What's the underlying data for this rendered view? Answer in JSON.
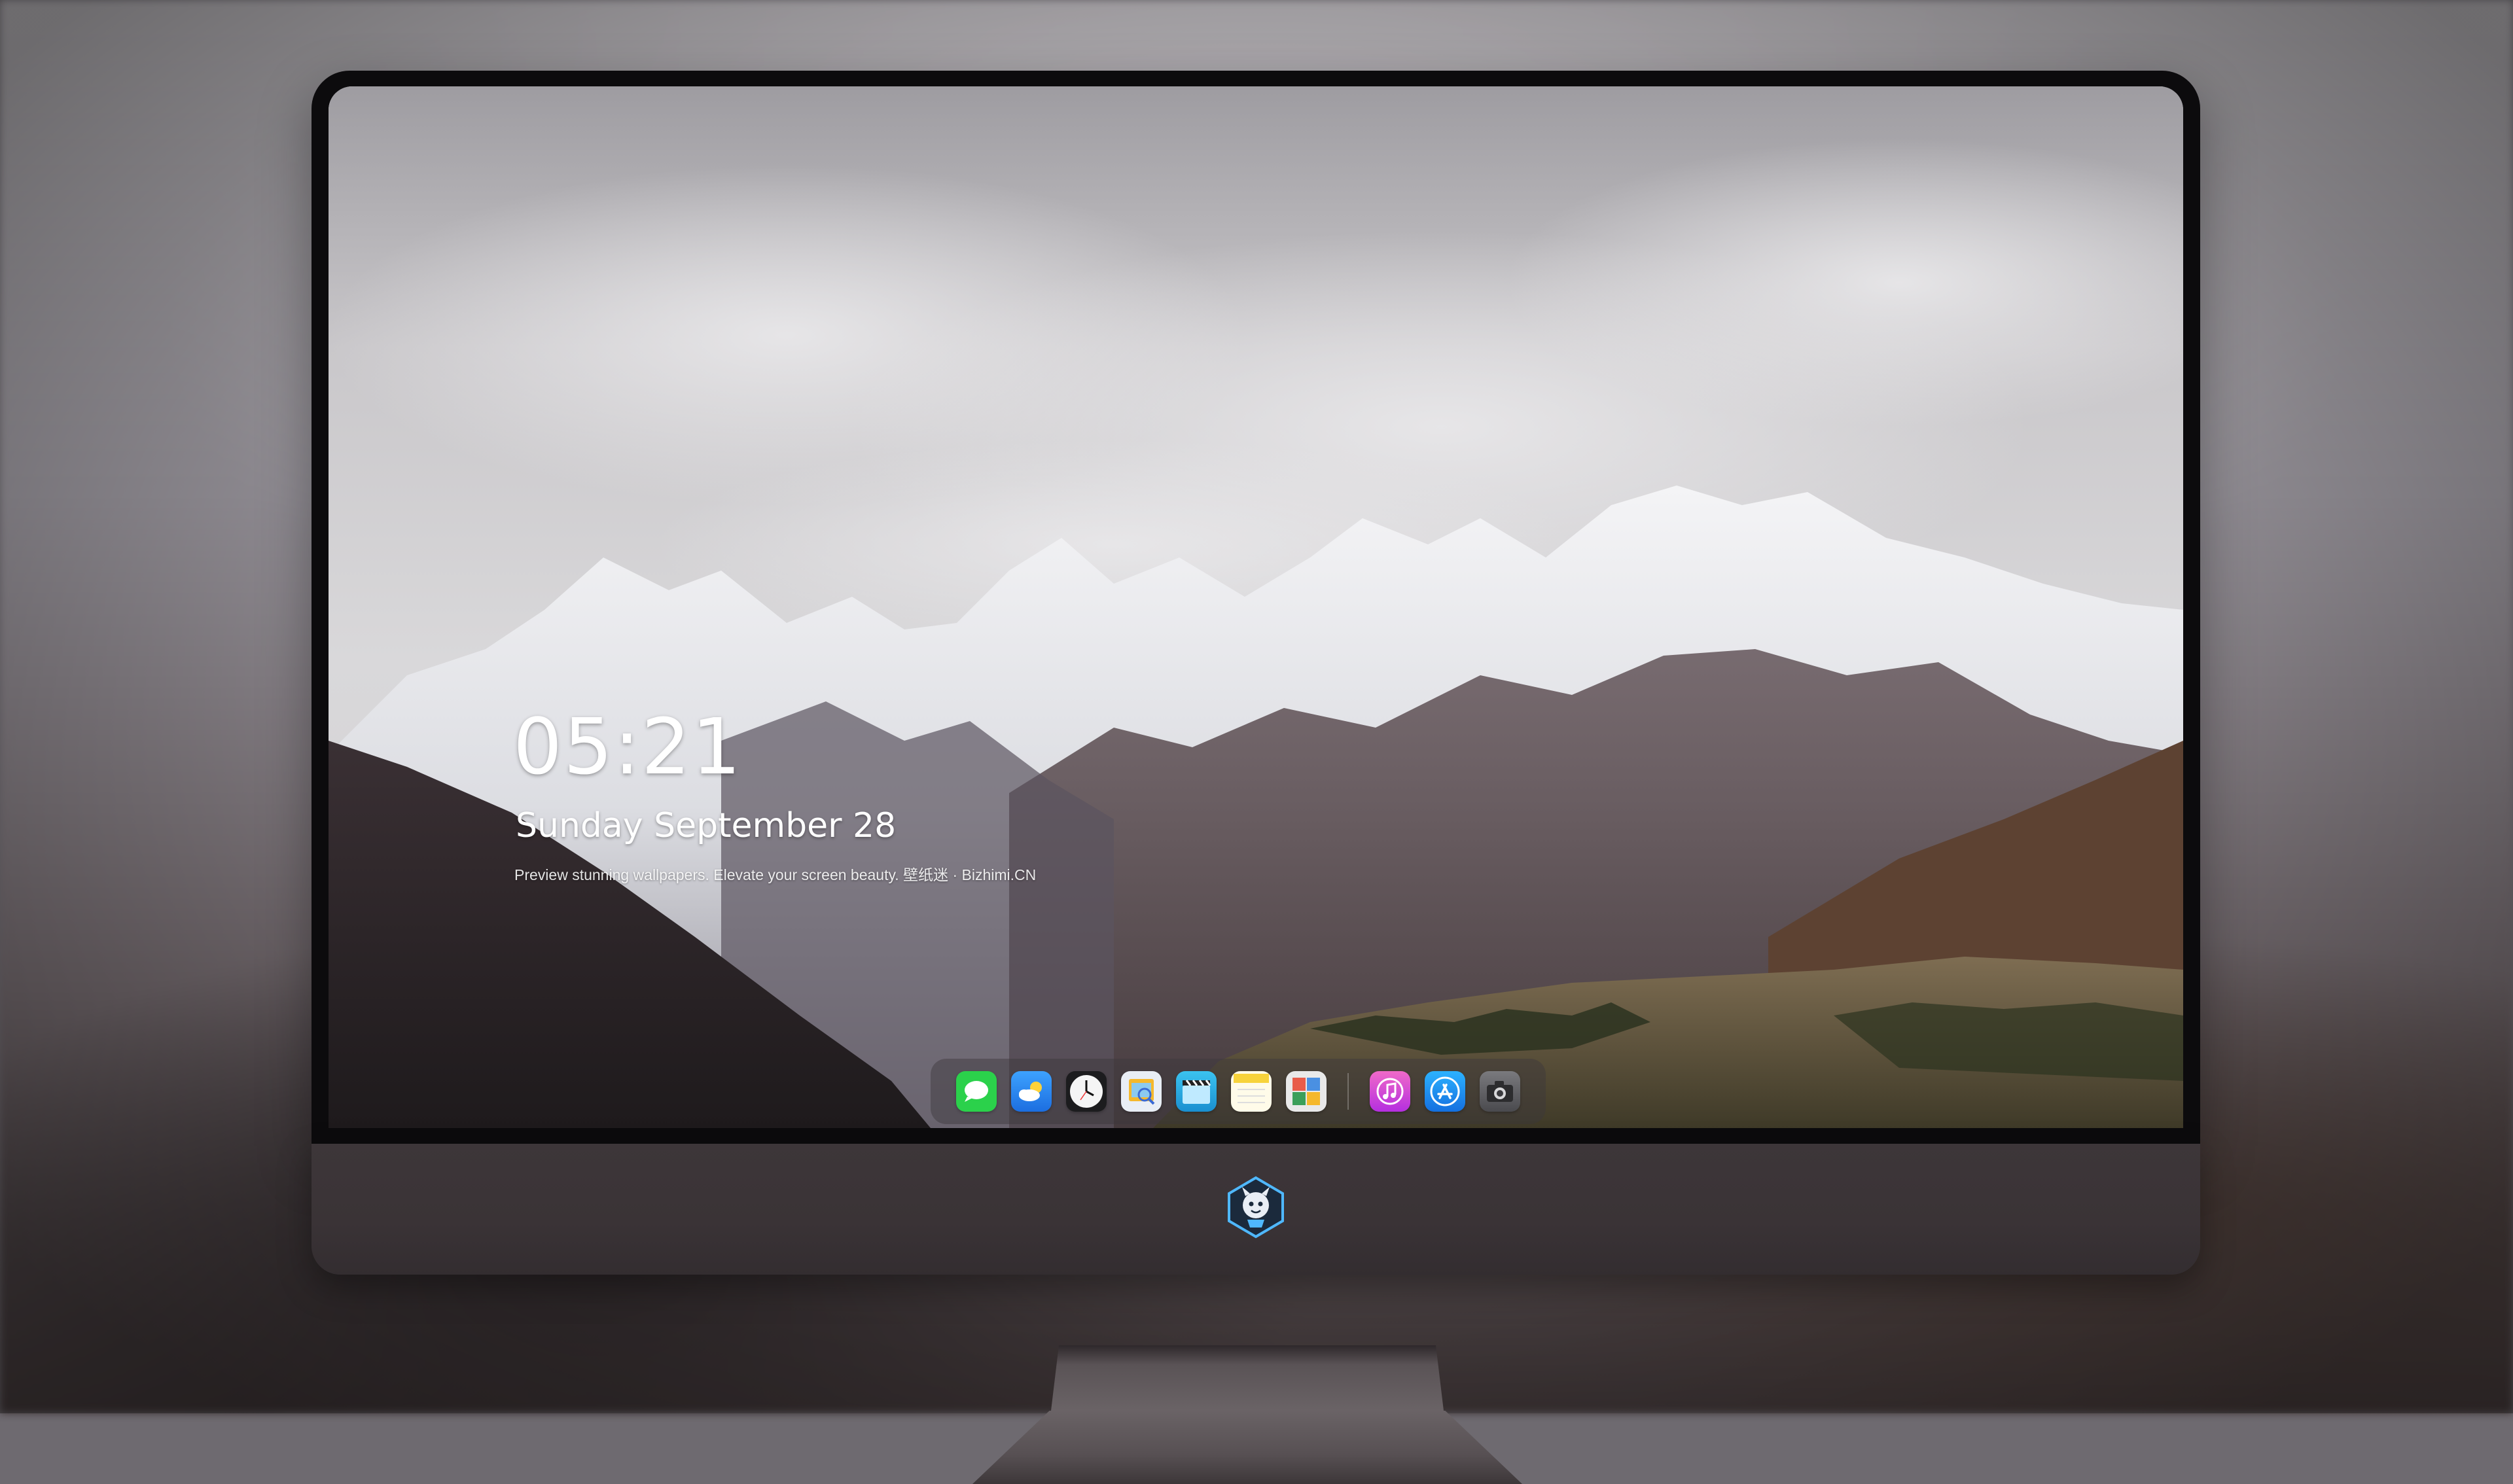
{
  "lock_screen": {
    "time": "05:21",
    "date": "Sunday September 28",
    "caption": "Preview stunning wallpapers. Elevate your screen beauty. 壁纸迷 · Bizhimi.CN"
  },
  "dock": {
    "apps": [
      {
        "icon": "messages-icon",
        "color": "#2bd14b"
      },
      {
        "icon": "weather-icon",
        "color": "#2f8df5"
      },
      {
        "icon": "clock-icon",
        "color": "#f2f2f2"
      },
      {
        "icon": "preview-icon",
        "color": "#f5b82c"
      },
      {
        "icon": "final-cut-icon",
        "color": "#3bc3f0"
      },
      {
        "icon": "notes-icon",
        "color": "#f7d33c"
      },
      {
        "icon": "photo-booth-icon",
        "color": "#3b9f5a"
      },
      {
        "icon": "itunes-icon",
        "color": "#e04fd4"
      },
      {
        "icon": "app-store-icon",
        "color": "#1f9cf0"
      },
      {
        "icon": "camera-icon",
        "color": "#5a5a5e"
      }
    ]
  },
  "monitor": {
    "chin_logo": "dragon-mascot-logo"
  }
}
